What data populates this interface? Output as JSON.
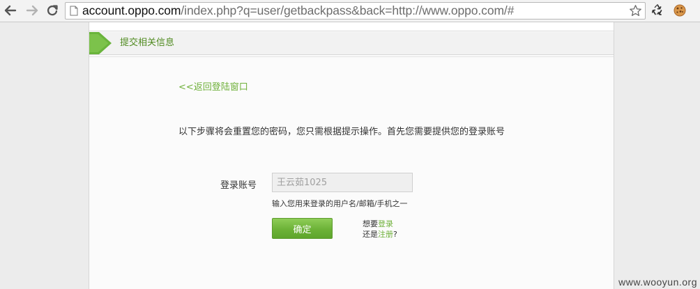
{
  "browser": {
    "url_host": "account.oppo.com",
    "url_rest": "/index.php?q=user/getbackpass&back=http://www.oppo.com/#"
  },
  "section": {
    "title": "提交相关信息"
  },
  "form": {
    "back_link": "<<返回登陆窗口",
    "intro": "以下步骤将会重置您的密码，您只需根据提示操作。首先您需要提供您的登录账号",
    "account_label": "登录账号",
    "account_value": "王云茹1025",
    "hint": "输入您用来登录的用户名/邮箱/手机之一",
    "confirm_label": "确定",
    "alt_prefix_1": "想要",
    "login_link": "登录",
    "alt_prefix_2": "还是",
    "register_link": "注册",
    "alt_suffix": "?"
  },
  "watermark": "www.wooyun.org",
  "colors": {
    "accent_green": "#6fb03a",
    "header_green": "#6ab43c"
  }
}
